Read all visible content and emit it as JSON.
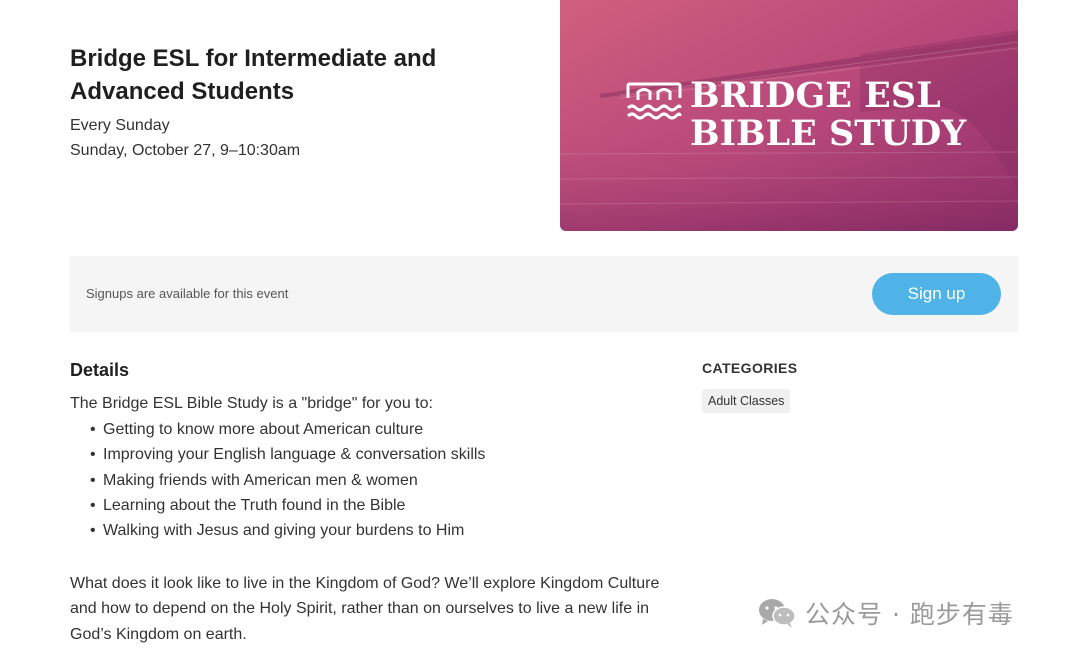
{
  "event": {
    "title": "Bridge ESL for Intermediate and Advanced Students",
    "recurrence": "Every Sunday",
    "date_time": "Sunday, October 27, 9–10:30am"
  },
  "hero": {
    "line1": "BRIDGE ESL",
    "line2": "BIBLE STUDY"
  },
  "signup": {
    "message": "Signups are available for this event",
    "button_label": "Sign up"
  },
  "details": {
    "heading": "Details",
    "intro": "The Bridge ESL Bible Study is a \"bridge\" for you to:",
    "bullets": [
      "Getting to know more about American culture",
      "Improving your English language & conversation skills",
      "Making friends with American men & women",
      "Learning about the Truth found in the Bible",
      "Walking with Jesus and giving your burdens to Him"
    ],
    "paragraph": "What does it look like to live in the Kingdom of God? We’ll explore Kingdom Culture and how to depend on the Holy Spirit, rather than on ourselves to live a new life in God’s Kingdom on earth."
  },
  "categories": {
    "heading": "CATEGORIES",
    "tags": [
      "Adult Classes"
    ]
  },
  "watermark": {
    "icon": "wechat-icon",
    "text": "公众号 · 跑步有毒"
  },
  "colors": {
    "accent": "#4fb3e8",
    "hero_overlay_start": "#d2607e",
    "hero_overlay_end": "#8a2a68"
  }
}
